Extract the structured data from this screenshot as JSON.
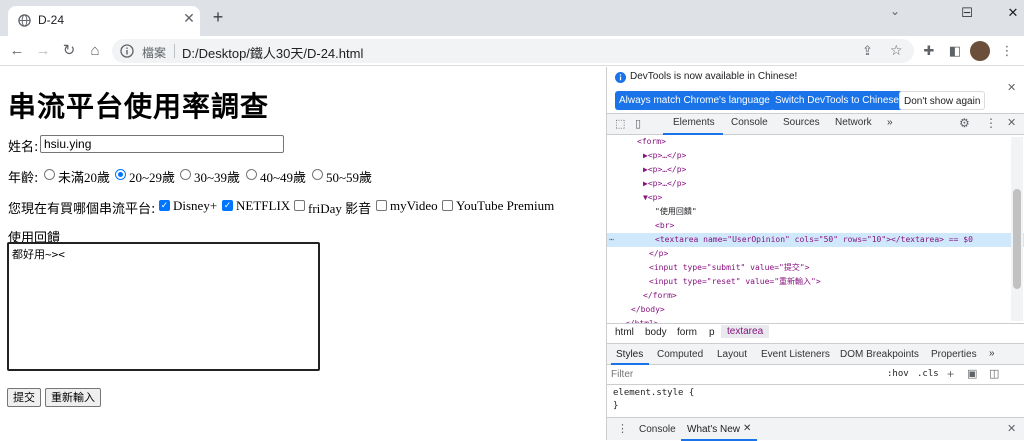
{
  "browser": {
    "tab_title": "D-24",
    "new_tab": "+",
    "window_controls": [
      "−",
      "☐",
      "✕"
    ],
    "omnibox_label": "檔案",
    "url": "D:/Desktop/鐵人30天/D-24.html"
  },
  "page": {
    "heading": "串流平台使用率調查",
    "name_label": "姓名:",
    "name_value": "hsiu.ying",
    "age_label": "年齡:",
    "age_options": [
      "未滿20歲",
      "20~29歲",
      "30~39歲",
      "40~49歲",
      "50~59歲"
    ],
    "age_selected": "20~29歲",
    "platform_label": "您現在有買哪個串流平台:",
    "platforms": [
      {
        "label": "Disney+",
        "checked": true
      },
      {
        "label": "NETFLIX",
        "checked": true
      },
      {
        "label": "friDay 影音",
        "checked": false
      },
      {
        "label": "myVideo",
        "checked": false
      },
      {
        "label": "YouTube Premium",
        "checked": false
      }
    ],
    "feedback_label": "使用回饋",
    "feedback_value": "都好用~><",
    "submit_label": "提交",
    "reset_label": "重新輸入"
  },
  "devtools": {
    "notice": "DevTools is now available in Chinese!",
    "btn_match": "Always match Chrome's language",
    "btn_switch": "Switch DevTools to Chinese",
    "btn_dont": "Don't show again",
    "tabs": [
      "Elements",
      "Console",
      "Sources",
      "Network",
      "»"
    ],
    "active_tab": "Elements",
    "dom_lines": [
      {
        "indent": 5,
        "text": "<form>",
        "kind": "tag"
      },
      {
        "indent": 6,
        "text": "▶<p>…</p>",
        "kind": "tag"
      },
      {
        "indent": 6,
        "text": "▶<p>…</p>",
        "kind": "tag"
      },
      {
        "indent": 6,
        "text": "▶<p>…</p>",
        "kind": "tag"
      },
      {
        "indent": 6,
        "text": "▼<p>",
        "kind": "tag"
      },
      {
        "indent": 8,
        "text": "\"使用回饋\"",
        "kind": "txt"
      },
      {
        "indent": 8,
        "text": "<br>",
        "kind": "tag"
      },
      {
        "indent": 8,
        "text": "<textarea name=\"UserOpinion\" cols=\"50\" rows=\"10\"></textarea> == $0",
        "kind": "sel"
      },
      {
        "indent": 7,
        "text": "</p>",
        "kind": "tag"
      },
      {
        "indent": 7,
        "text": "<input type=\"submit\" value=\"提交\">",
        "kind": "tag"
      },
      {
        "indent": 7,
        "text": "<input type=\"reset\" value=\"重新輸入\">",
        "kind": "tag"
      },
      {
        "indent": 6,
        "text": "</form>",
        "kind": "tag"
      },
      {
        "indent": 4,
        "text": "</body>",
        "kind": "tag"
      },
      {
        "indent": 3,
        "text": "</html>",
        "kind": "tag"
      }
    ],
    "breadcrumbs": [
      "html",
      "body",
      "form",
      "p",
      "textarea"
    ],
    "styles_tabs": [
      "Styles",
      "Computed",
      "Layout",
      "Event Listeners",
      "DOM Breakpoints",
      "Properties",
      "»"
    ],
    "filter_placeholder": "Filter",
    "hov": ":hov",
    "cls": ".cls",
    "element_style": "element.style {",
    "element_style_close": "}",
    "drawer_tabs": [
      "Console",
      "What's New"
    ]
  },
  "colors": {
    "accent": "#1a73e8",
    "check": "#0075ff",
    "tag": "#881280",
    "attr": "#994500",
    "value": "#1a1aa6"
  }
}
